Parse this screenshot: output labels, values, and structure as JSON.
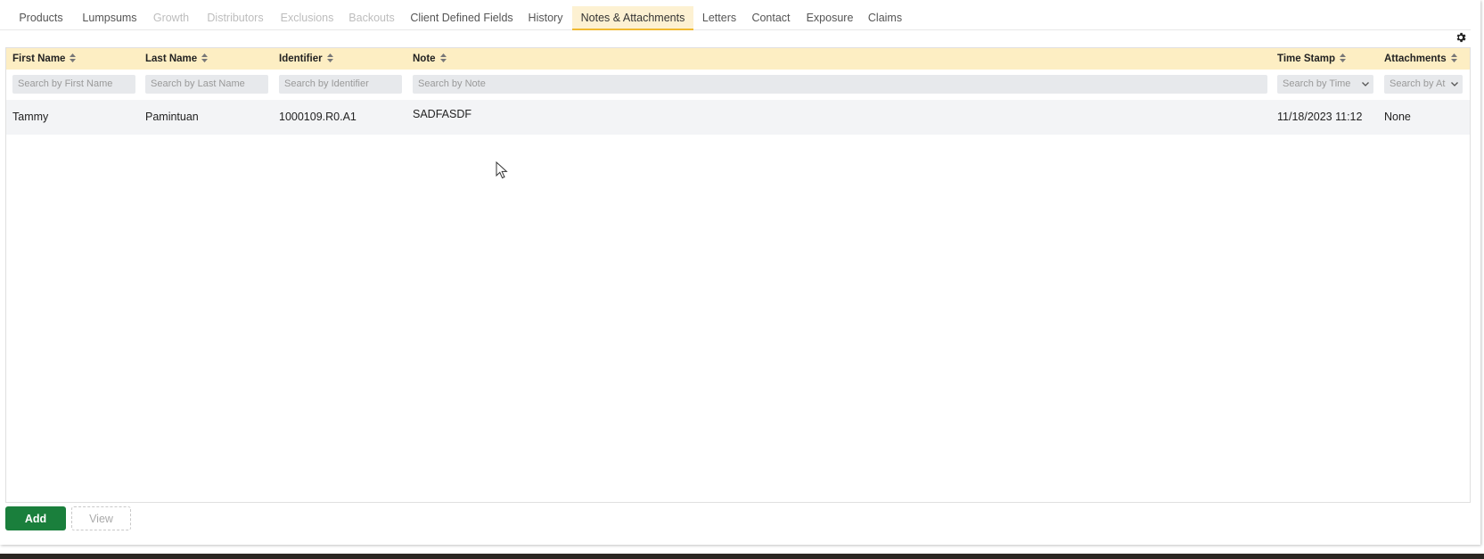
{
  "tabs": [
    {
      "label": "Products",
      "state": "normal"
    },
    {
      "label": "Lumpsums",
      "state": "normal"
    },
    {
      "label": "Growth",
      "state": "disabled"
    },
    {
      "label": "Distributors",
      "state": "disabled"
    },
    {
      "label": "Exclusions",
      "state": "disabled"
    },
    {
      "label": "Backouts",
      "state": "disabled"
    },
    {
      "label": "Client Defined Fields",
      "state": "normal"
    },
    {
      "label": "History",
      "state": "normal"
    },
    {
      "label": "Notes & Attachments",
      "state": "active"
    },
    {
      "label": "Letters",
      "state": "normal"
    },
    {
      "label": "Contact",
      "state": "normal"
    },
    {
      "label": "Exposure",
      "state": "normal"
    },
    {
      "label": "Claims",
      "state": "normal"
    }
  ],
  "grid": {
    "columns": [
      {
        "label": "First Name",
        "placeholder": "Search by First Name"
      },
      {
        "label": "Last Name",
        "placeholder": "Search by Last Name"
      },
      {
        "label": "Identifier",
        "placeholder": "Search by Identifier"
      },
      {
        "label": "Note",
        "placeholder": "Search by Note"
      },
      {
        "label": "Time Stamp",
        "placeholder": "Search by Time"
      },
      {
        "label": "Attachments",
        "placeholder": "Search by At"
      }
    ],
    "rows": [
      {
        "first_name": "Tammy",
        "last_name": "Pamintuan",
        "identifier": "1000109.R0.A1",
        "note": "SADFASDF",
        "time_stamp": "11/18/2023 11:12",
        "attachments": "None"
      }
    ]
  },
  "actions": {
    "add_label": "Add",
    "view_label": "View"
  },
  "colors": {
    "accent": "#f0b930",
    "header_bg": "#fdeec3",
    "add_button": "#1a7f3c"
  },
  "icons": {
    "settings": "gear-icon",
    "sort": "sort-icon",
    "dropdown": "chevron-down-icon",
    "pointer": "mouse-cursor-icon"
  }
}
